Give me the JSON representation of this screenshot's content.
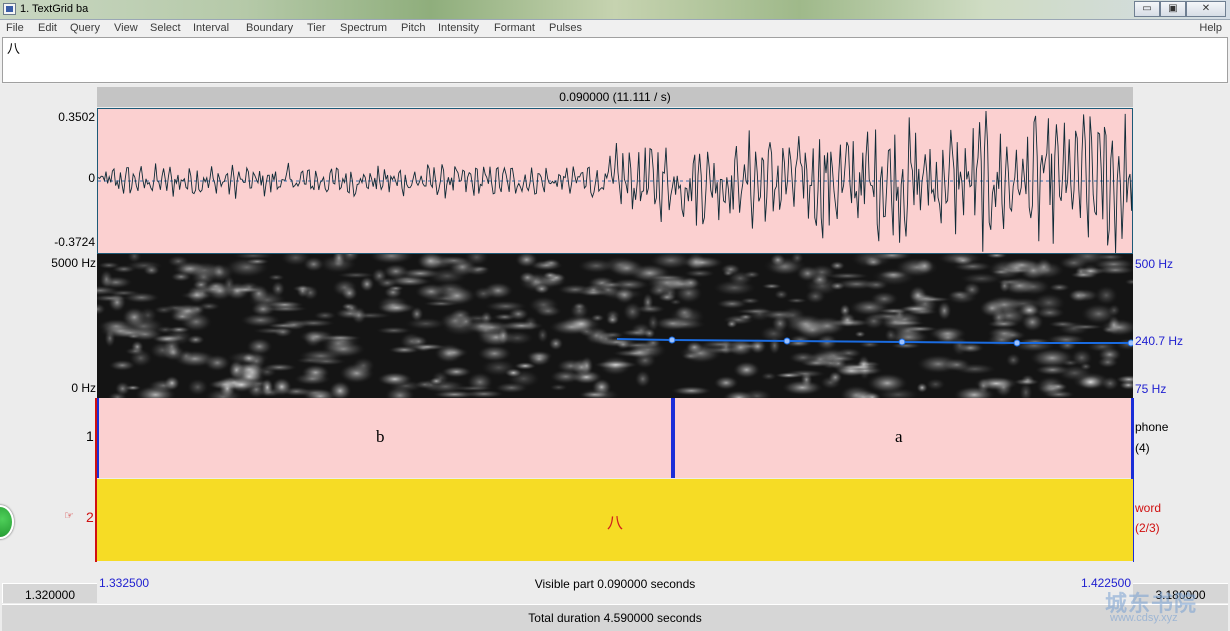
{
  "window": {
    "title": "1. TextGrid ba",
    "buttons": [
      "▭",
      "▣",
      "✕"
    ]
  },
  "menu": {
    "items": [
      "File",
      "Edit",
      "Query",
      "View",
      "Select",
      "Interval",
      "Boundary",
      "Tier",
      "Spectrum",
      "Pitch",
      "Intensity",
      "Formant",
      "Pulses"
    ],
    "help": "Help"
  },
  "text_area": {
    "value": "八"
  },
  "selection": {
    "label": "0.090000 (11.111 / s)"
  },
  "waveform": {
    "y_max": "0.3502",
    "y_zero": "0",
    "y_min": "-0.3724"
  },
  "spectrogram": {
    "freq_max": "5000 Hz",
    "freq_min": "0 Hz",
    "pitch_max": "500 Hz",
    "pitch_value": "240.7 Hz",
    "pitch_min": "75 Hz"
  },
  "tiers": [
    {
      "number": "1",
      "name": "phone",
      "count": "(4)",
      "intervals": [
        "b",
        "a"
      ]
    },
    {
      "number": "2",
      "pointer": "☞",
      "name": "word",
      "count": "(2/3)",
      "intervals": [
        "八"
      ]
    }
  ],
  "time": {
    "window_start": "1.320000",
    "visible_start": "1.332500",
    "visible_end": "1.422500",
    "window_end": "3.180000",
    "visible_part": "Visible part 0.090000 seconds",
    "total": "Total duration 4.590000 seconds"
  },
  "watermark": {
    "text": "城东书院",
    "url": "www.cdsy.xyz"
  },
  "colors": {
    "wave_bg": "#fbd0d0",
    "tier2_bg": "#f6dc25",
    "pitch_line": "#1a6be0",
    "boundary": "#1a2ed8",
    "accent_red": "#d01010"
  }
}
